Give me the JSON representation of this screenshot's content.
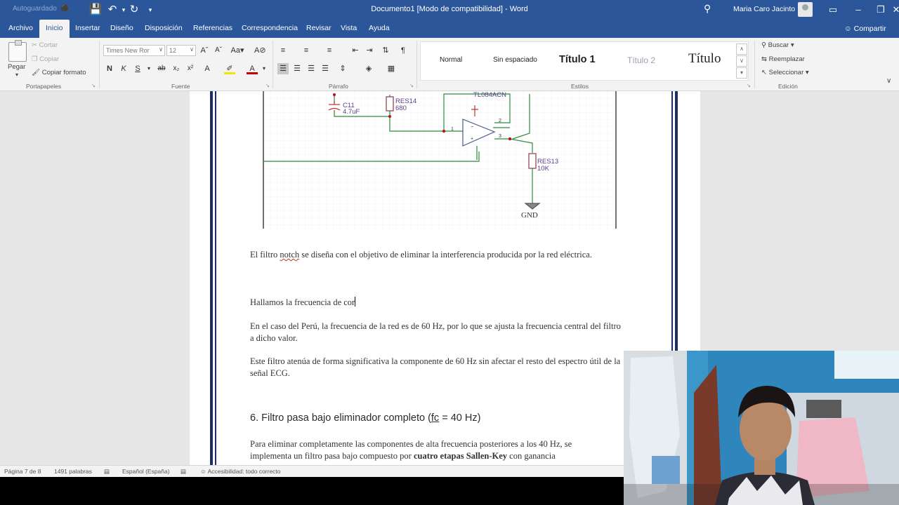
{
  "titlebar": {
    "autosave": "Autoguardado",
    "autosave_state": "⚫",
    "title": "Documento1 [Modo de compatibilidad] - Word",
    "user": "Maria Caro Jacinto"
  },
  "tabs": [
    "Archivo",
    "Inicio",
    "Insertar",
    "Diseño",
    "Disposición",
    "Referencias",
    "Correspondencia",
    "Revisar",
    "Vista",
    "Ayuda"
  ],
  "share_label": "Compartir",
  "clipboard": {
    "paste": "Pegar",
    "cut": "Cortar",
    "copy": "Copiar",
    "format_painter": "Copiar formato",
    "group": "Portapapeles"
  },
  "font": {
    "name": "Times New Ror",
    "size": "12",
    "group": "Fuente"
  },
  "paragraph": {
    "group": "Párrafo"
  },
  "styles": {
    "items": [
      "Normal",
      "Sin espaciado",
      "Título 1",
      "Título 2",
      "Título"
    ],
    "group": "Estilos"
  },
  "editing": {
    "find": "Buscar",
    "replace": "Reemplazar",
    "select": "Seleccionar",
    "group": "Edición"
  },
  "schematic": {
    "cap_name": "C11",
    "cap_value": "4.7uF",
    "res14_name": "RES14",
    "res14_value": "680",
    "opamp": "TL084ACN",
    "res13_name": "RES13",
    "res13_value": "10K",
    "gnd": "GND",
    "pin1": "1",
    "pin2": "2",
    "pin3": "3"
  },
  "document": {
    "p1_before": "El filtro ",
    "p1_misspelled": "notch",
    "p1_after": " se diseña con el objetivo de eliminar la interferencia producida por la red eléctrica.",
    "p2": "Hallamos la frecuencia de cor",
    "p3": "En el caso del Perú, la frecuencia de la red es de 60 Hz, por lo que se ajusta la frecuencia central del filtro a dicho valor.",
    "p4": "Este filtro atenúa de forma significativa la componente de 60 Hz sin afectar el resto del espectro útil de la señal ECG.",
    "heading_before": "6. Filtro pasa bajo eliminador completo (",
    "heading_fc": "fc",
    "heading_after": " = 40 Hz)",
    "p5_line1": "Para eliminar completamente las componentes de alta frecuencia posteriores a los 40 Hz, se",
    "p5_line2_a": "implementa un filtro pasa bajo compuesto por ",
    "p5_line2_bold": "cuatro etapas Sallen-Key",
    "p5_line2_b": " con ganancia"
  },
  "statusbar": {
    "page": "Página 7 de 8",
    "words": "1491 palabras",
    "language": "Español (España)",
    "accessibility": "Accesibilidad: todo correcto"
  },
  "colors": {
    "word_blue": "#2b579a",
    "ribbon_bg": "#f3f3f3",
    "page_border": "#1e2c6a",
    "schematic_wire": "#2e8b3a",
    "component_red": "#c0303a",
    "schematic_label": "#5a3f8a"
  }
}
